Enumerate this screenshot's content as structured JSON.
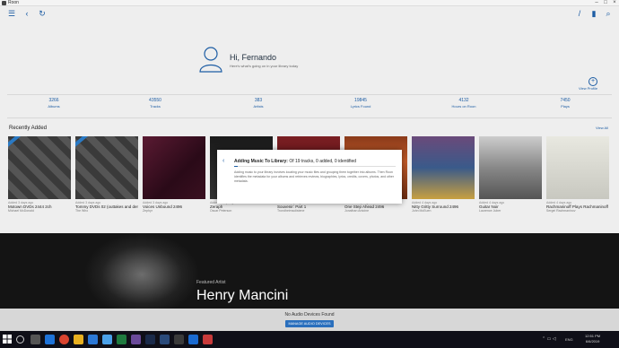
{
  "window": {
    "title": "Roon"
  },
  "colors": {
    "accent": "#1d5da4",
    "badge": "#2a7ac5"
  },
  "toolbar": {
    "icons": [
      "menu-icon",
      "back-icon",
      "refresh-icon",
      "settings-icon",
      "bookmark-icon",
      "search-icon"
    ]
  },
  "profile": {
    "greeting": "Hi, Fernando",
    "subtitle": "Here's what's going on in your library today",
    "view_profile": "View Profile",
    "view_profile_glyph": "+"
  },
  "stats": [
    {
      "num": "3266",
      "label": "Albums"
    },
    {
      "num": "43550",
      "label": "Tracks"
    },
    {
      "num": "383",
      "label": "Artists"
    },
    {
      "num": "19845",
      "label": "Lyrics Found"
    },
    {
      "num": "4132",
      "label": "Hours on Roon"
    },
    {
      "num": "7450",
      "label": "Plays"
    }
  ],
  "recent": {
    "title": "Recently Added",
    "view_all": "View All",
    "albums": [
      {
        "added": "Added 3 days ago",
        "name": "Motown DVDs 2444 2ch",
        "artist": "Michael McDonald"
      },
      {
        "added": "Added 3 days ago",
        "name": "Tommy DVDs 02 (outtakes and demos) 2496 2ch",
        "artist": "The Who"
      },
      {
        "added": "Added 3 days ago",
        "name": "Voices Unbound 2496",
        "artist": "Zephyr"
      },
      {
        "added": "Added 4 days ago",
        "name": "Zeraph",
        "artist": "Oscar Peterson"
      },
      {
        "added": "Added 4 days ago",
        "name": "Souvenir: Part 1",
        "artist": "Trondheimsolistene"
      },
      {
        "added": "Added 4 days ago",
        "name": "One Step Ahead 2496",
        "artist": "Jonathan Antoine"
      },
      {
        "added": "Added 4 days ago",
        "name": "Nitty Gritty Surround 2496",
        "artist": "John McEuen"
      },
      {
        "added": "Added 4 days ago",
        "name": "Guitar Noir",
        "artist": "Laurence Juber"
      },
      {
        "added": "Added 4 days ago",
        "name": "Rachmaninoff Plays Rachmaninoff 2488",
        "artist": "Sergei Rachmaninov"
      }
    ]
  },
  "modal": {
    "back": "‹",
    "title": "Adding Music To Library:",
    "status": "Of 19 tracks, 0 added, 0 identified",
    "progress": 0.02,
    "body": "Adding music to your library involves locating your music files and grouping them together into albums. Then Roon identifies the metadata for your albums and retrieves reviews, biographies, lyrics, credits, covers, photos, and other metadata."
  },
  "featured": {
    "label": "Featured Artist",
    "name": "Henry Mancini"
  },
  "audio": {
    "status": "No Audio Devices Found",
    "button": "MANAGE AUDIO DEVICES"
  },
  "taskbar": {
    "time": "12:51 PM",
    "date": "6/6/2019",
    "lang": "ENG"
  }
}
